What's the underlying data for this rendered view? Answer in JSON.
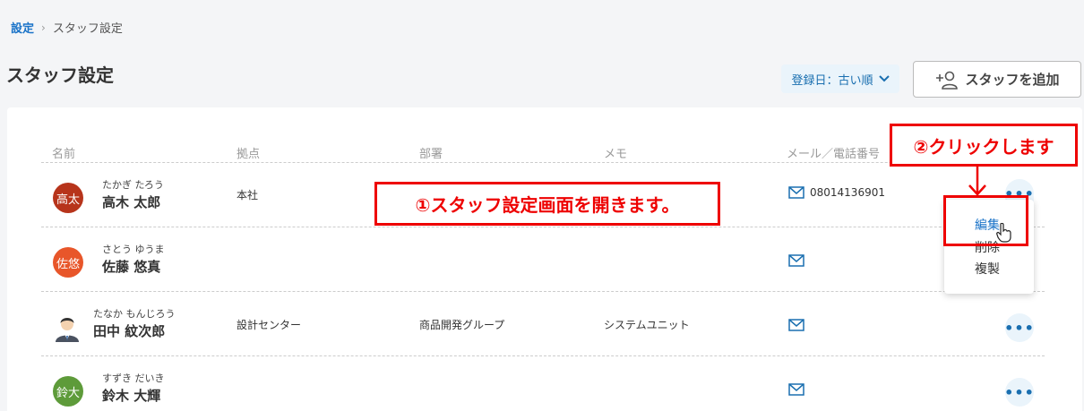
{
  "breadcrumb": {
    "parent": "設定",
    "separator": "›",
    "current": "スタッフ設定"
  },
  "page": {
    "title": "スタッフ設定"
  },
  "toolbar": {
    "sort_label": "登録日：古い順",
    "add_label": "スタッフを追加"
  },
  "table": {
    "headers": {
      "name": "名前",
      "location": "拠点",
      "department": "部署",
      "memo": "メモ",
      "contact": "メール／電話番号"
    },
    "rows": [
      {
        "avatar": "高太",
        "avatar_color": "#b7341b",
        "kana": "たかぎ たろう",
        "name": "高木 太郎",
        "location": "本社",
        "department": "",
        "memo": "",
        "phone": "08014136901"
      },
      {
        "avatar": "佐悠",
        "avatar_color": "#e8562a",
        "kana": "さとう ゆうま",
        "name": "佐藤 悠真",
        "location": "",
        "department": "",
        "memo": "",
        "phone": ""
      },
      {
        "avatar": "",
        "avatar_color": "#ffffff",
        "kana": "たなか もんじろう",
        "name": "田中 紋次郎",
        "location": "設計センター",
        "department": "商品開発グループ",
        "memo": "システムユニット",
        "phone": ""
      },
      {
        "avatar": "鈴大",
        "avatar_color": "#5e9b3a",
        "kana": "すずき だいき",
        "name": "鈴木 大輝",
        "location": "",
        "department": "",
        "memo": "",
        "phone": ""
      }
    ]
  },
  "context_menu": {
    "edit": "編集",
    "delete": "削除",
    "duplicate": "複製"
  },
  "annotations": {
    "step1": "①スタッフ設定画面を開きます。",
    "step2": "②クリックします"
  },
  "colors": {
    "accent": "#1a73c8",
    "annotation": "#e00000"
  }
}
